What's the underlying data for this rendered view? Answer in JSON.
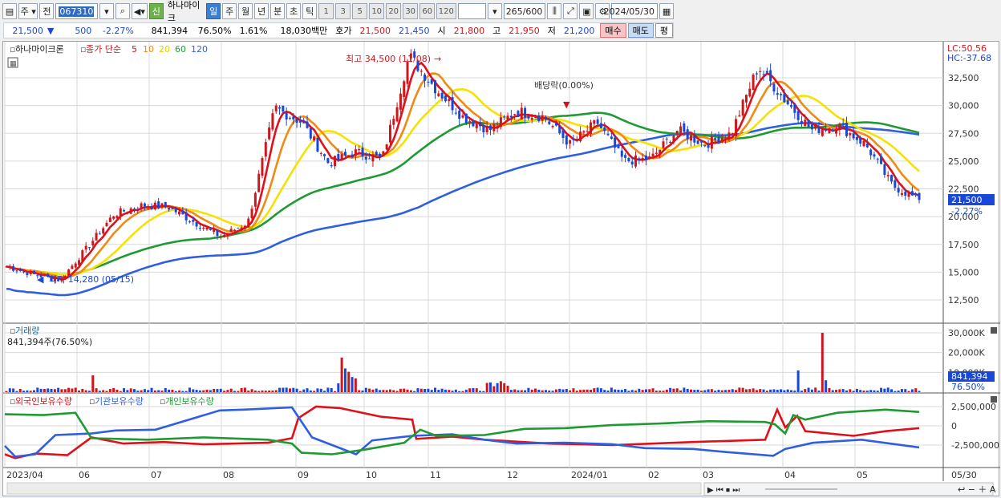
{
  "toolbar": {
    "unit_label": "주",
    "prev_label": "전",
    "stock_code": "067310",
    "badge_label": "신",
    "stock_name": "하나마이크",
    "periods": [
      "일",
      "주",
      "월",
      "년",
      "분",
      "초",
      "틱"
    ],
    "active_period": "일",
    "intervals": [
      "1",
      "3",
      "5",
      "10",
      "20",
      "30",
      "60",
      "120"
    ],
    "count_value": "265",
    "count_total": "/600",
    "date_value": "2024/05/30"
  },
  "inforow": {
    "price": "21,500",
    "change": "500",
    "change_pct": "-2.27%",
    "volume": "841,394",
    "volume_ratio": "76.50%",
    "turnover": "1.61%",
    "amount": "18,030백만",
    "quote_label": "호가",
    "ask": "21,500",
    "bid": "21,450",
    "open_label": "시",
    "open": "21,800",
    "high_label": "고",
    "high": "21,950",
    "low_label": "저",
    "low": "21,200",
    "buy_label": "매수",
    "sell_label": "매도",
    "avg_label": "평"
  },
  "colors": {
    "up": "#d0161d",
    "down": "#1948d8",
    "ma5": "#e0101a",
    "ma10": "#f08a12",
    "ma20": "#f5e200",
    "ma60": "#1f9a33",
    "ma120": "#2f5fe0"
  },
  "price_panel": {
    "legend_name": "하나마이크론",
    "legend_type": "종가 단순",
    "ma_labels": [
      "5",
      "10",
      "20",
      "60",
      "120"
    ],
    "high_annotation": "최고 34,500 (11/08)",
    "low_annotation": "최저 14,280 (05/15)",
    "dividend_annotation": "배당락(0.00%)",
    "lc_label": "LC:50.56",
    "hc_label": "HC:-37.68",
    "current_price": "21,500",
    "current_pct": "-2.27%",
    "y_ticks": [
      "32,500",
      "30,000",
      "27,500",
      "25,000",
      "22,500",
      "20,000",
      "17,500",
      "15,000",
      "12,500"
    ]
  },
  "volume_panel": {
    "title": "거래량",
    "value_label": "841,394주(76.50%)",
    "y_ticks": [
      "30,000K",
      "20,000K",
      "10,000K"
    ],
    "current": "841,394",
    "current_pct": "76.50%"
  },
  "holding_panel": {
    "series": [
      "외국인보유수량",
      "기관보유수량",
      "개인보유수량"
    ],
    "y_ticks": [
      "2,500,000",
      "0",
      "-2,500,000"
    ]
  },
  "x_axis": {
    "labels": [
      "2023/04",
      "06",
      "07",
      "08",
      "09",
      "10",
      "11",
      "12",
      "2024/01",
      "02",
      "03",
      "04",
      "05"
    ],
    "right_label": "05/30"
  },
  "chart_data": {
    "type": "candlestick",
    "anchors": [
      [
        "2023/04",
        15500
      ],
      [
        "2023/05",
        14800
      ],
      [
        "2023/05/15",
        14280
      ],
      [
        "2023/06",
        17200
      ],
      [
        "2023/06/20",
        20200
      ],
      [
        "2023/07",
        21000
      ],
      [
        "2023/07/20",
        20900
      ],
      [
        "2023/08",
        19500
      ],
      [
        "2023/08/20",
        18200
      ],
      [
        "2023/08/31",
        19500
      ],
      [
        "2023/09/05",
        29800
      ],
      [
        "2023/09/20",
        28500
      ],
      [
        "2023/10",
        24800
      ],
      [
        "2023/10/20",
        25800
      ],
      [
        "2023/11",
        25200
      ],
      [
        "2023/11/08",
        34500
      ],
      [
        "2023/11/20",
        31500
      ],
      [
        "2023/12",
        29000
      ],
      [
        "2023/12/15",
        27800
      ],
      [
        "2023/12/28",
        29500
      ],
      [
        "2024/01",
        29000
      ],
      [
        "2024/01/15",
        26500
      ],
      [
        "2024/02",
        28500
      ],
      [
        "2024/02/10",
        25000
      ],
      [
        "2024/02/25",
        25200
      ],
      [
        "2024/03",
        27800
      ],
      [
        "2024/03/15",
        26500
      ],
      [
        "2024/04",
        27500
      ],
      [
        "2024/04/05",
        33500
      ],
      [
        "2024/04/15",
        30500
      ],
      [
        "2024/04/25",
        27800
      ],
      [
        "2024/05",
        28200
      ],
      [
        "2024/05/15",
        26500
      ],
      [
        "2024/05/25",
        22800
      ],
      [
        "2024/05/30",
        21500
      ]
    ],
    "ylim": [
      12500,
      32500
    ],
    "volume_ylim_k": [
      0,
      30000
    ],
    "holding_ylim": [
      -2500000,
      2500000
    ]
  }
}
